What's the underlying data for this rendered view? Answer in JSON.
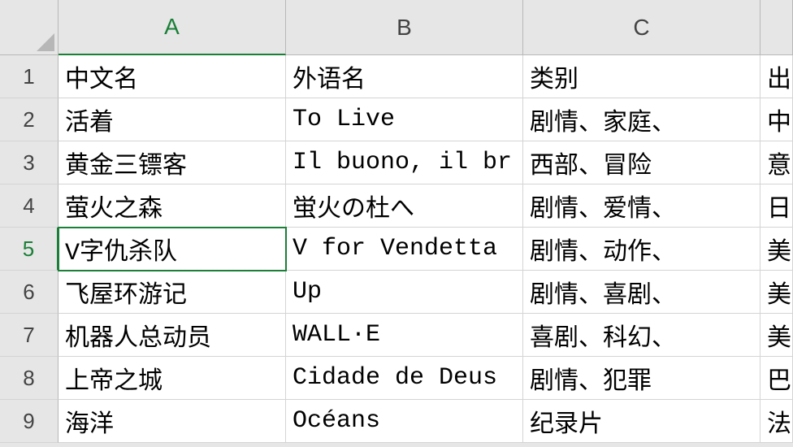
{
  "columns": [
    "A",
    "B",
    "C",
    ""
  ],
  "rowNumbers": [
    "1",
    "2",
    "3",
    "4",
    "5",
    "6",
    "7",
    "8",
    "9"
  ],
  "activeColumn": "A",
  "activeRow": "5",
  "selectedCell": {
    "row": 5,
    "col": 0
  },
  "rows": [
    {
      "a": "中文名",
      "b": "外语名",
      "c": "类别",
      "d": "出"
    },
    {
      "a": "活着",
      "b": "To Live",
      "c": "剧情、家庭、",
      "d": "中"
    },
    {
      "a": "黄金三镖客",
      "b": "Il buono, il br",
      "c": "西部、冒险",
      "d": "意"
    },
    {
      "a": "萤火之森",
      "b": "蛍火の杜へ",
      "c": "剧情、爱情、",
      "d": "日"
    },
    {
      "a": "V字仇杀队",
      "b": "V for Vendetta",
      "c": "剧情、动作、",
      "d": "美"
    },
    {
      "a": "飞屋环游记",
      "b": "Up",
      "c": "剧情、喜剧、",
      "d": "美"
    },
    {
      "a": "机器人总动员",
      "b": "WALL·E",
      "c": "喜剧、科幻、",
      "d": "美"
    },
    {
      "a": "上帝之城",
      "b": "Cidade de Deus",
      "c": "剧情、犯罪",
      "d": "巴"
    },
    {
      "a": "海洋",
      "b": "Océans",
      "c": "纪录片",
      "d": "法"
    }
  ]
}
